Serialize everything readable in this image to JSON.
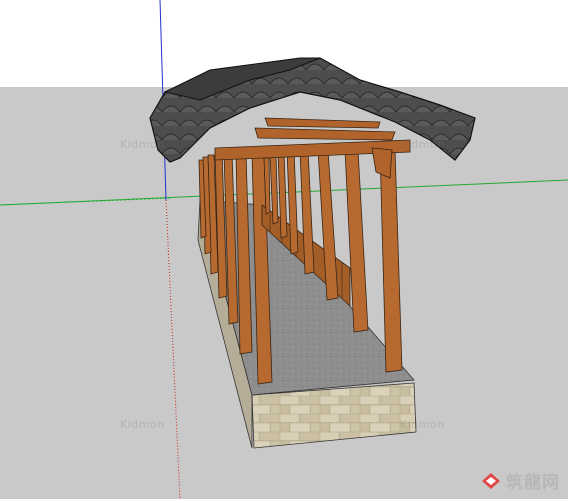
{
  "scene": {
    "sky_color": "#ffffff",
    "ground_color": "#c9c9c9",
    "axis_colors": {
      "red": "#cc2222",
      "green": "#22aa33",
      "blue": "#2233cc"
    },
    "roof_tile_color": "#4a4a4a",
    "timber_color": "#b4682f",
    "floor_color": "#8f8f8f",
    "base_stone_color": "#cfc4a8"
  },
  "watermarks": {
    "text": "Kidmon"
  },
  "logo": {
    "icon": "zhulong-logo-icon",
    "text": "筑龍网"
  }
}
